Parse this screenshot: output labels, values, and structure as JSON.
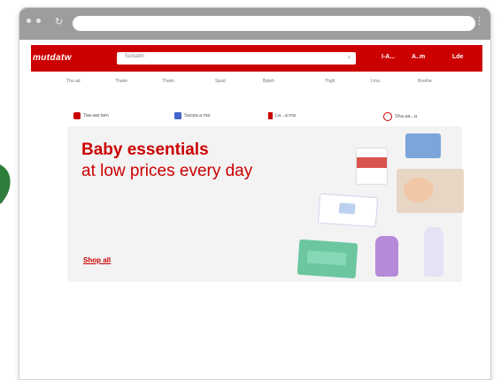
{
  "brand": {
    "logo_text": "mutdatw",
    "red": "#cc0000",
    "dark_green": "#2f7d3b"
  },
  "browser": {
    "refresh_icon": "refresh-icon",
    "menu_icon": "kebab-menu-icon"
  },
  "header": {
    "search_placeholder": "Sutsatm",
    "account_links": [
      "I-A...",
      "A..m",
      "Lde"
    ]
  },
  "nav": {
    "items": [
      "",
      "Thu ad",
      "Thaim",
      "Thaim",
      "Spud",
      "Bpleh",
      "Thgh",
      "Lmu.",
      "Boeiha",
      ""
    ]
  },
  "promos": {
    "items": [
      "Taa-aar.lam",
      "Sacpa.a.ma",
      "La...a.ma",
      "Sha.aa...a"
    ]
  },
  "hero": {
    "headline": "Baby essentials",
    "subheadline": "at low prices every day",
    "cta": "Shop all"
  }
}
